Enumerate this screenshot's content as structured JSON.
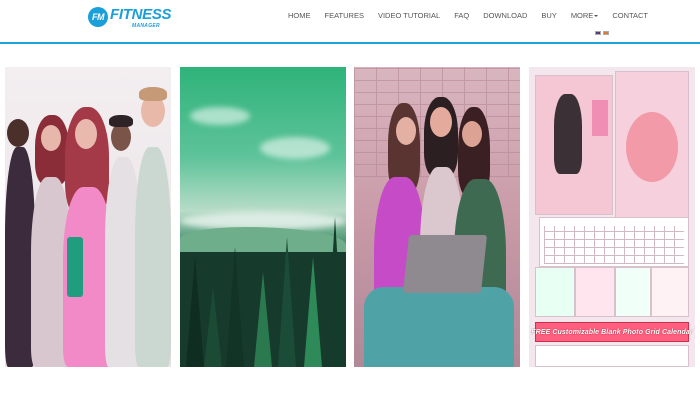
{
  "brand": {
    "badge": "FM",
    "name": "FITNESS",
    "sub": "MANAGER"
  },
  "nav": {
    "items": [
      {
        "label": "HOME"
      },
      {
        "label": "FEATURES"
      },
      {
        "label": "VIDEO TUTORIAL"
      },
      {
        "label": "FAQ"
      },
      {
        "label": "DOWNLOAD"
      },
      {
        "label": "BUY"
      },
      {
        "label": "MORE"
      },
      {
        "label": "CONTACT"
      }
    ]
  },
  "flags": [
    "flag-uk-icon",
    "flag-es-icon"
  ],
  "colors": {
    "accent": "#1aa3d9",
    "nav_text": "#555555",
    "banner": "#ff5f7f"
  },
  "gallery": {
    "banner_text": "FREE Customizable Blank Photo Grid Calendar"
  }
}
